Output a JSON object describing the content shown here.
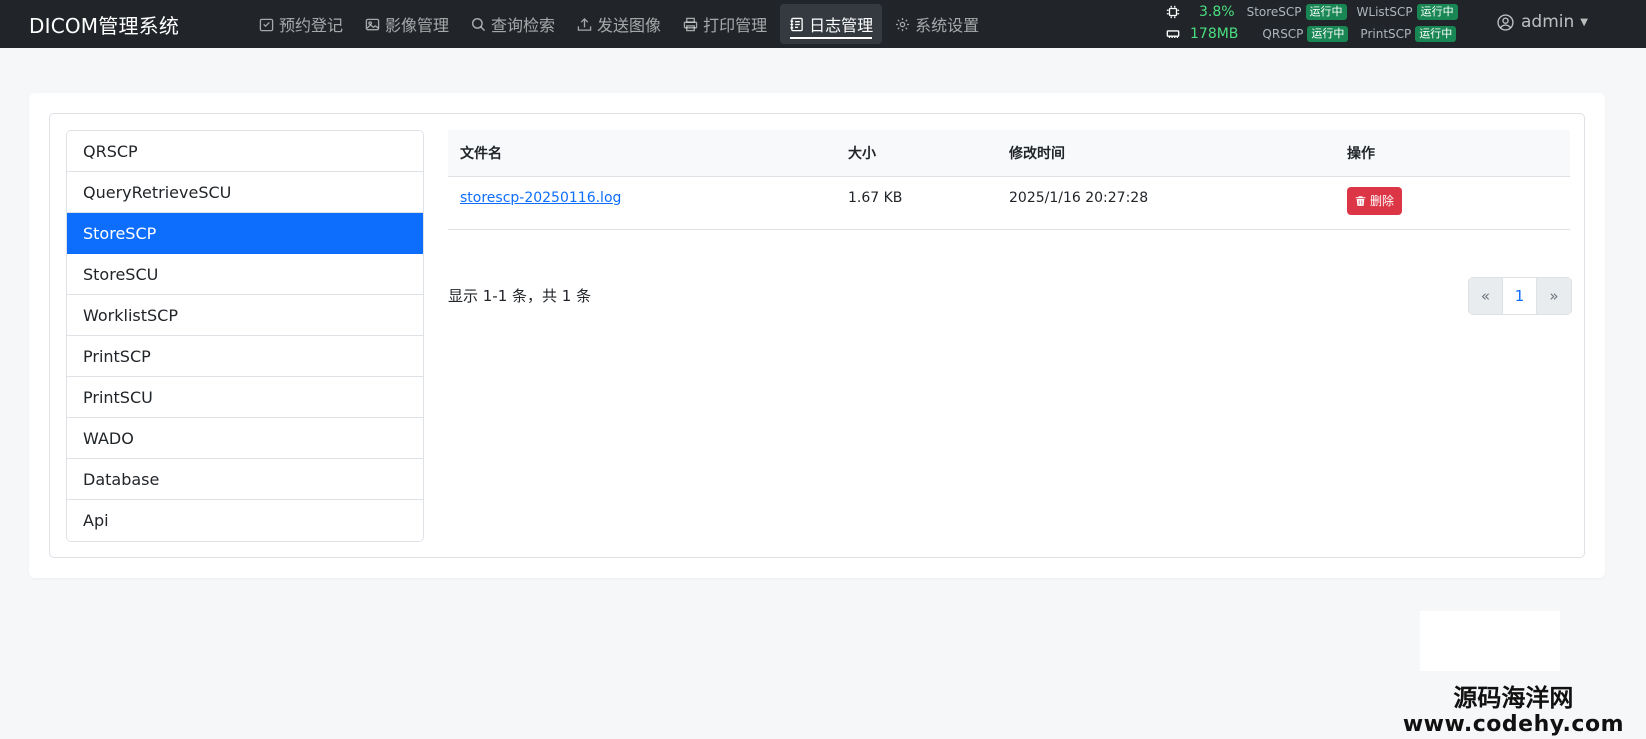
{
  "brand": "DICOM管理系统",
  "nav": [
    {
      "label": "预约登记",
      "icon": "calendar-check-icon"
    },
    {
      "label": "影像管理",
      "icon": "image-icon"
    },
    {
      "label": "查询检索",
      "icon": "search-icon"
    },
    {
      "label": "发送图像",
      "icon": "upload-icon"
    },
    {
      "label": "打印管理",
      "icon": "printer-icon"
    },
    {
      "label": "日志管理",
      "icon": "journal-icon",
      "active": true
    },
    {
      "label": "系统设置",
      "icon": "gear-icon"
    }
  ],
  "system": {
    "cpu": "3.8%",
    "memory": "178MB",
    "services": [
      {
        "name": "StoreSCP",
        "status": "运行中"
      },
      {
        "name": "WListSCP",
        "status": "运行中"
      },
      {
        "name": "QRSCP",
        "status": "运行中"
      },
      {
        "name": "PrintSCP",
        "status": "运行中"
      }
    ]
  },
  "user": {
    "name": "admin"
  },
  "log_sources": [
    "QRSCP",
    "QueryRetrieveSCU",
    "StoreSCP",
    "StoreSCU",
    "WorklistSCP",
    "PrintSCP",
    "PrintSCU",
    "WADO",
    "Database",
    "Api"
  ],
  "active_source": "StoreSCP",
  "table": {
    "headers": [
      "文件名",
      "大小",
      "修改时间",
      "操作"
    ],
    "rows": [
      {
        "filename": "storescp-20250116.log",
        "size": "1.67 KB",
        "modified": "2025/1/16 20:27:28",
        "action": "删除"
      }
    ]
  },
  "summary": "显示 1-1 条，共 1 条",
  "pagination": {
    "prev": "«",
    "current": "1",
    "next": "»"
  },
  "watermark": {
    "line1": "源码海洋网",
    "line2": "www.codehy.com"
  }
}
